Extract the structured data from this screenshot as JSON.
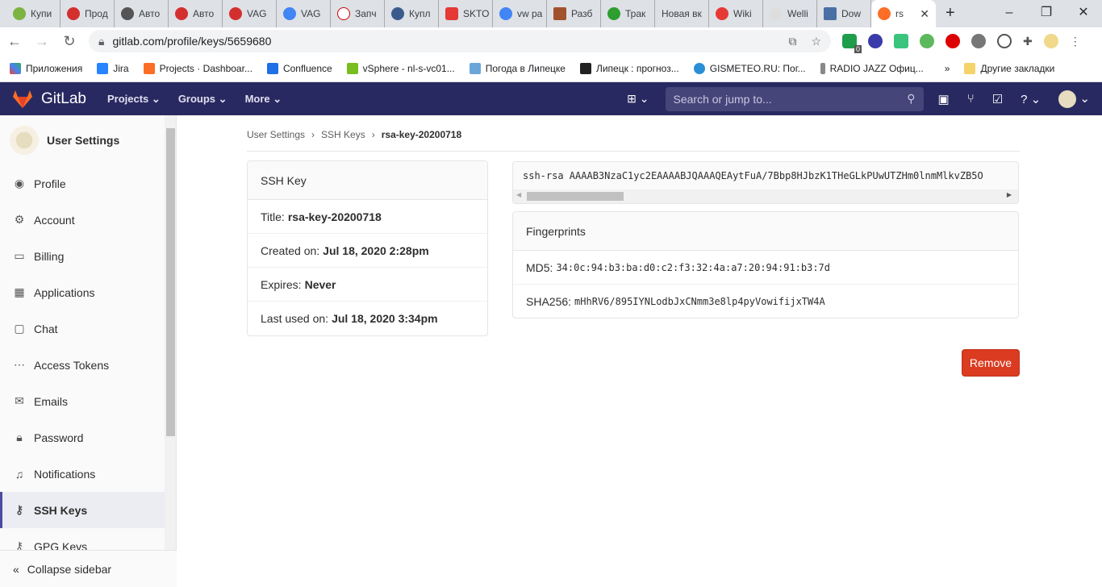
{
  "browser": {
    "tabs": [
      "Купи",
      "Прод",
      "Авто",
      "Авто",
      "VAG",
      "VAG",
      "Запч",
      "Купл",
      "SKTO",
      "vw pa",
      "Разб",
      "Трак",
      "Новая вк",
      "Wiki",
      "Welli",
      "Dow"
    ],
    "active_tab": "rs",
    "url": "gitlab.com/profile/keys/5659680",
    "ext_badge": "0",
    "bookmarks": [
      "Приложения",
      "Jira",
      "Projects · Dashboar...",
      "Confluence",
      "vSphere - nl-s-vc01...",
      "Погода в Липецке",
      "Липецк : прогноз...",
      "GISMETEO.RU: Пог...",
      "RADIO JAZZ Офиц..."
    ],
    "more": "»",
    "other_bookmarks": "Другие закладки"
  },
  "topnav": {
    "brand": "GitLab",
    "menus": [
      "Projects",
      "Groups",
      "More"
    ],
    "search_placeholder": "Search or jump to..."
  },
  "sidebar": {
    "title": "User Settings",
    "items": [
      "Profile",
      "Account",
      "Billing",
      "Applications",
      "Chat",
      "Access Tokens",
      "Emails",
      "Password",
      "Notifications",
      "SSH Keys",
      "GPG Keys"
    ],
    "collapse": "Collapse sidebar"
  },
  "breadcrumb": [
    "User Settings",
    "SSH Keys",
    "rsa-key-20200718"
  ],
  "ssh_key": {
    "header": "SSH Key",
    "title_label": "Title:",
    "title": "rsa-key-20200718",
    "created_label": "Created on:",
    "created": "Jul 18, 2020 2:28pm",
    "expires_label": "Expires:",
    "expires": "Never",
    "last_used_label": "Last used on:",
    "last_used": "Jul 18, 2020 3:34pm"
  },
  "key_text": "ssh-rsa AAAAB3NzaC1yc2EAAAABJQAAAQEAytFuA/7Bbp8HJbzK1THeGLkPUwUTZHm0lnmMlkvZB5O",
  "fingerprints": {
    "header": "Fingerprints",
    "md5_label": "MD5:",
    "md5": "34:0c:94:b3:ba:d0:c2:f3:32:4a:a7:20:94:91:b3:7d",
    "sha_label": "SHA256:",
    "sha": "mHhRV6/895IYNLodbJxCNmm3e8lp4pyVowifijxTW4A"
  },
  "remove_label": "Remove"
}
